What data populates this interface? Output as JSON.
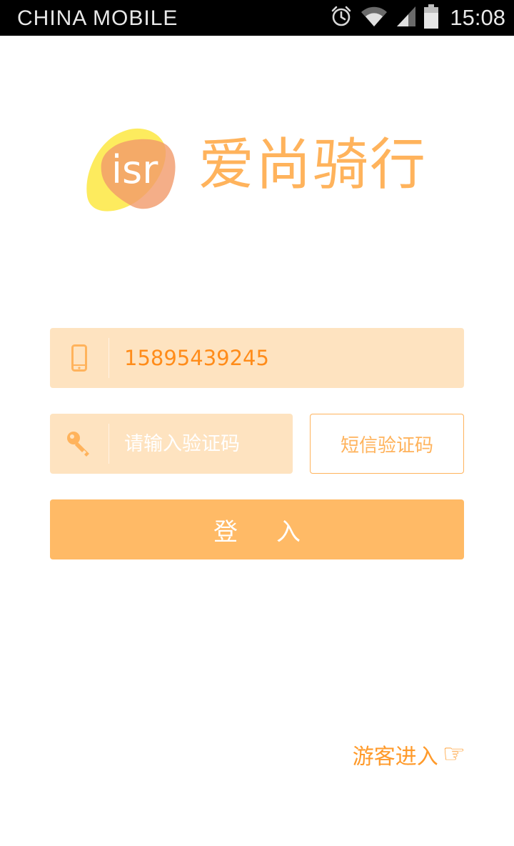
{
  "status_bar": {
    "carrier": "CHINA  MOBILE",
    "time": "15:08",
    "icons": [
      "alarm-icon",
      "wifi-icon",
      "signal-icon",
      "battery-icon"
    ]
  },
  "logo": {
    "mark_text": "isr",
    "title": "爱尚骑行"
  },
  "login_form": {
    "phone": {
      "icon": "phone-icon",
      "value": "15895439245"
    },
    "code": {
      "icon": "key-icon",
      "placeholder": "请输入验证码",
      "value": ""
    },
    "sms_button_label": "短信验证码",
    "login_button_label": "登入"
  },
  "guest": {
    "label": "游客进入",
    "icon": "pointing-hand-icon"
  },
  "colors": {
    "accent": "#ffb35c",
    "field_bg": "#fee3c0",
    "button_bg": "#ffba66",
    "guest_text": "#ff9a2a"
  }
}
